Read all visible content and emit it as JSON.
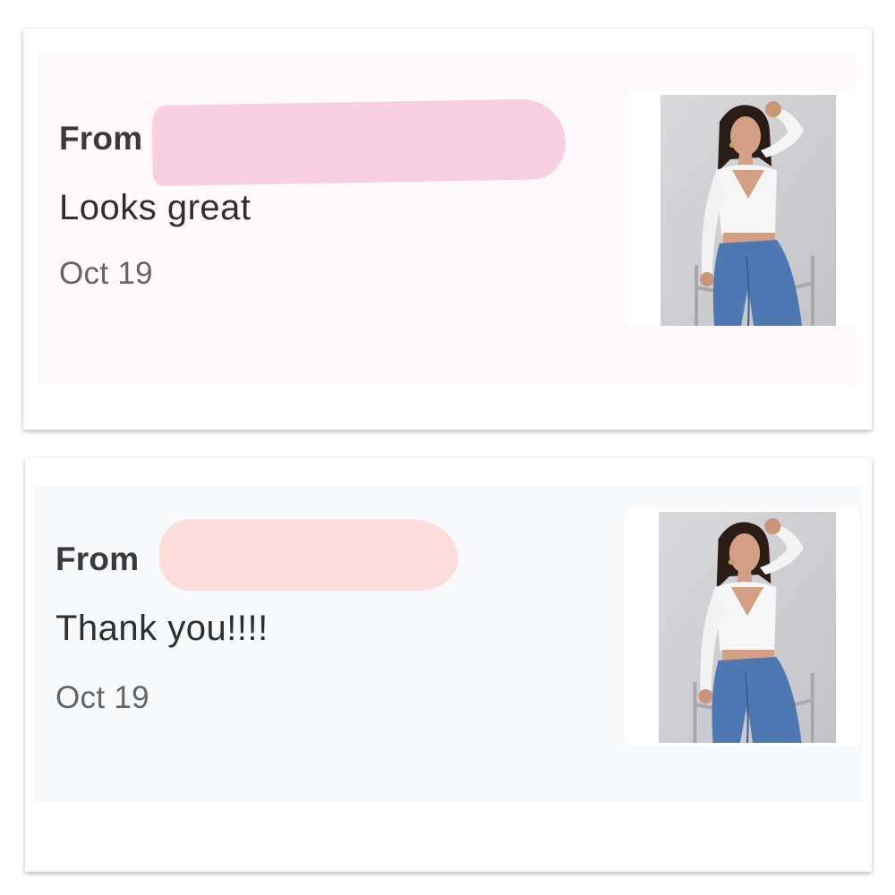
{
  "notifications": [
    {
      "from_label": "From",
      "message": "Looks great",
      "date": "Oct 19",
      "thumbnail_icon": "product-photo-icon"
    },
    {
      "from_label": "From",
      "message": "Thank you!!!!",
      "date": "Oct 19",
      "thumbnail_icon": "product-photo-icon"
    }
  ],
  "colors": {
    "card_1_background": "#fdf9fa",
    "card_2_background": "#f8f9fb",
    "redaction_1": "#f8cfe0",
    "redaction_2": "#fddcdc"
  }
}
